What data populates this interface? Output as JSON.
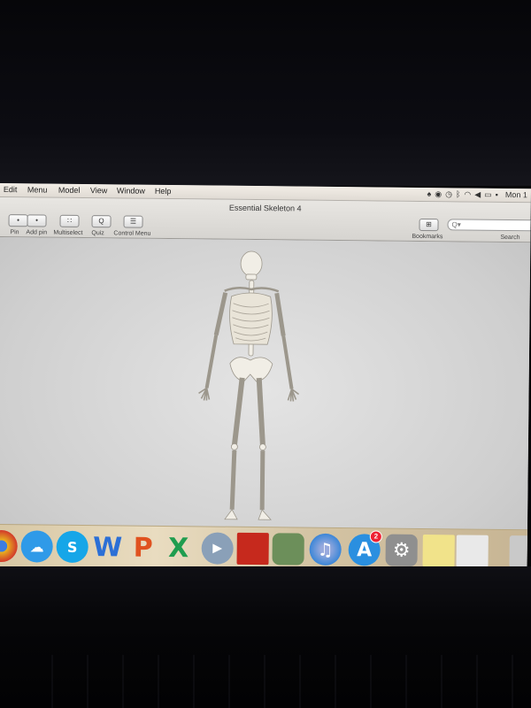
{
  "menubar": {
    "menus": [
      "Edit",
      "Menu",
      "Model",
      "View",
      "Window",
      "Help"
    ],
    "clock": "Mon 1",
    "status_icons": [
      "bell-icon",
      "eye-icon",
      "clock-icon",
      "bluetooth-icon",
      "wifi-icon",
      "volume-icon",
      "battery-icon",
      "flag-icon"
    ]
  },
  "window": {
    "title": "Essential Skeleton 4"
  },
  "toolbar": {
    "buttons": [
      {
        "id": "pin",
        "label": "Pin",
        "glyph": "•"
      },
      {
        "id": "add-pin",
        "label": "Add pin",
        "glyph": "•"
      },
      {
        "id": "multiselect",
        "label": "Multiselect",
        "glyph": "∷"
      },
      {
        "id": "quiz",
        "label": "Quiz",
        "glyph": "Q"
      },
      {
        "id": "control-menu",
        "label": "Control Menu",
        "glyph": "☰"
      }
    ],
    "bookmarks_label": "Bookmarks",
    "search_label": "Search",
    "search_placeholder": "Q▾"
  },
  "dock": {
    "apps": [
      {
        "name": "chrome-icon",
        "color": "#e8b21f"
      },
      {
        "name": "messages-icon",
        "color": "#2f9ae8"
      },
      {
        "name": "skype-icon",
        "color": "#16a6e8",
        "glyph": "S"
      },
      {
        "name": "word-icon",
        "color": "#2b6fd6",
        "glyph": "W"
      },
      {
        "name": "powerpoint-icon",
        "color": "#e0521f",
        "glyph": "P"
      },
      {
        "name": "excel-icon",
        "color": "#1f9d4f",
        "glyph": "X"
      },
      {
        "name": "facetime-icon",
        "color": "#8aa0b8"
      },
      {
        "name": "photo-booth-icon",
        "color": "#c6291d"
      },
      {
        "name": "preview-icon",
        "color": "#6c8f5a"
      },
      {
        "name": "iphoto-icon",
        "color": "#4c8fbf"
      },
      {
        "name": "itunes-icon",
        "color": "#2a7fd6",
        "glyph": "♫"
      },
      {
        "name": "app-store-icon",
        "color": "#2a8fe0",
        "glyph": "A",
        "badge": "2"
      },
      {
        "name": "system-preferences-icon",
        "color": "#8f8f8f",
        "glyph": "⚙"
      },
      {
        "name": "stickies-icon",
        "color": "#f1e38a"
      },
      {
        "name": "essential-skeleton-icon",
        "color": "#e9e9e9"
      },
      {
        "name": "trash-icon",
        "color": "#c9c9c9"
      }
    ]
  }
}
